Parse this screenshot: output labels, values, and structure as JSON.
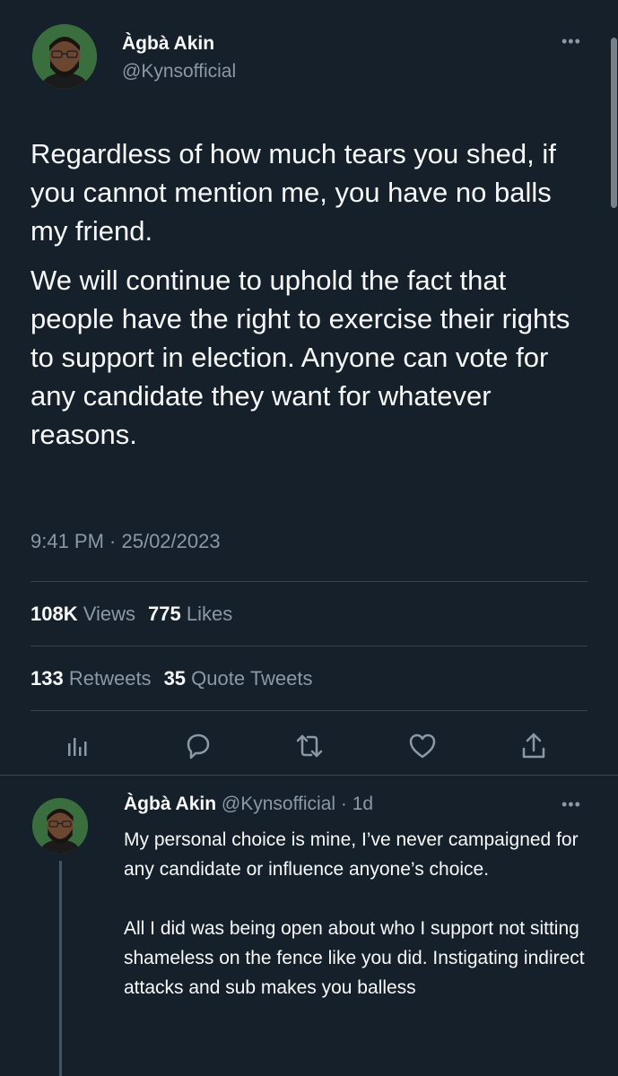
{
  "tweet": {
    "author_name": "Àgbà Akin",
    "author_handle": "@Kynsofficial",
    "more_label": "•••",
    "paragraph_1": "Regardless of how much tears you shed, if you cannot mention me, you have no balls my friend.",
    "paragraph_2": "We will continue to uphold the fact that people have the right to exercise their rights to support in election. Anyone can vote for any candidate they want for whatever reasons.",
    "timestamp": "9:41 PM · 25/02/2023",
    "views_count": "108K",
    "views_label": "Views",
    "likes_count": "775",
    "likes_label": "Likes",
    "retweets_count": "133",
    "retweets_label": "Retweets",
    "quotes_count": "35",
    "quotes_label": "Quote Tweets"
  },
  "actions": [
    {
      "icon": "analytics-icon"
    },
    {
      "icon": "reply-icon"
    },
    {
      "icon": "retweet-icon"
    },
    {
      "icon": "like-icon"
    },
    {
      "icon": "share-icon"
    }
  ],
  "reply": {
    "author_name": "Àgbà Akin",
    "author_handle": "@Kynsofficial",
    "separator": " · ",
    "age": "1d",
    "more_label": "•••",
    "text": "My personal choice is mine, I’ve never campaigned for any candidate or influence anyone’s choice.\n\nAll I did was being open about who I support not sitting shameless on the fence like you did. Instigating indirect attacks and sub makes you balless"
  },
  "colors": {
    "background": "#15202b",
    "text": "#f7f9f9",
    "secondary": "#8b98a5",
    "divider": "#38444d"
  }
}
